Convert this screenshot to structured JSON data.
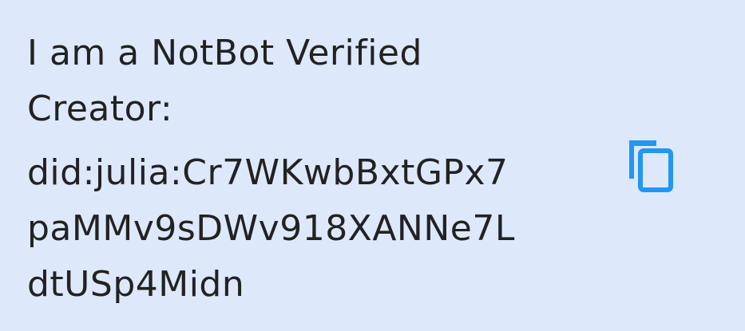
{
  "card": {
    "heading_line1": "I am a NotBot Verified",
    "heading_line2": "Creator:",
    "did_lines": [
      "did:julia:Cr7WKwbBxtGPx7",
      "paMMv9sDWv918XANNe7L",
      "dtUSp4Midn"
    ],
    "copy_icon": "copy-icon",
    "accent_color": "#2196f3",
    "background_color": "#dde9fb"
  }
}
